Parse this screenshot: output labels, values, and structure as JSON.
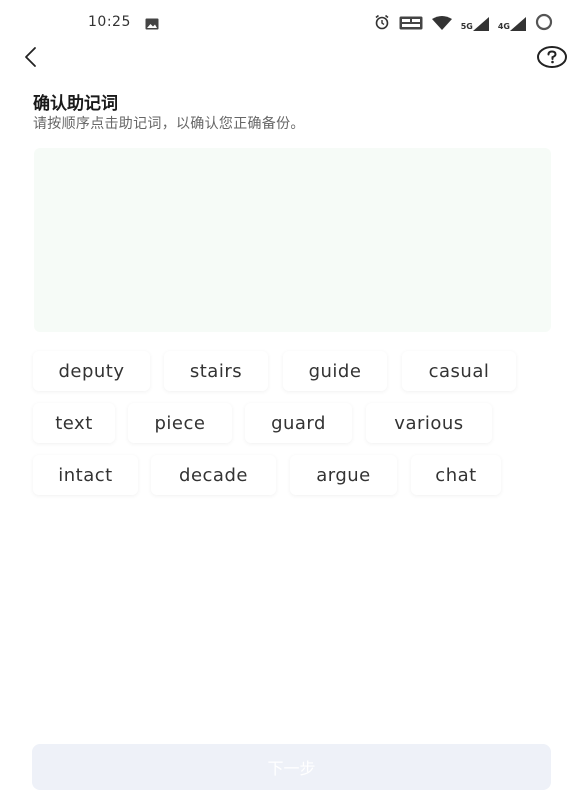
{
  "status_bar": {
    "time": "10:25",
    "signal_labels": [
      "5G",
      "4G"
    ],
    "icons": [
      "gallery-icon",
      "alarm-icon",
      "volte-icon",
      "wifi-icon",
      "signal-icon",
      "battery-icon"
    ]
  },
  "header": {
    "back_icon": "chevron-left-icon",
    "help_icon": "question-circle-icon"
  },
  "page": {
    "title": "确认助记词",
    "subtitle": "请按顺序点击助记词，以确认您正确备份。"
  },
  "words": [
    "deputy",
    "stairs",
    "guide",
    "casual",
    "text",
    "piece",
    "guard",
    "various",
    "intact",
    "decade",
    "argue",
    "chat"
  ],
  "next_button": {
    "label": "下一步"
  },
  "colors": {
    "selected_area_bg": "#f6fbf7",
    "next_button_bg": "#eef1f8",
    "text_primary": "#1a1a1a",
    "text_secondary": "#666666"
  }
}
